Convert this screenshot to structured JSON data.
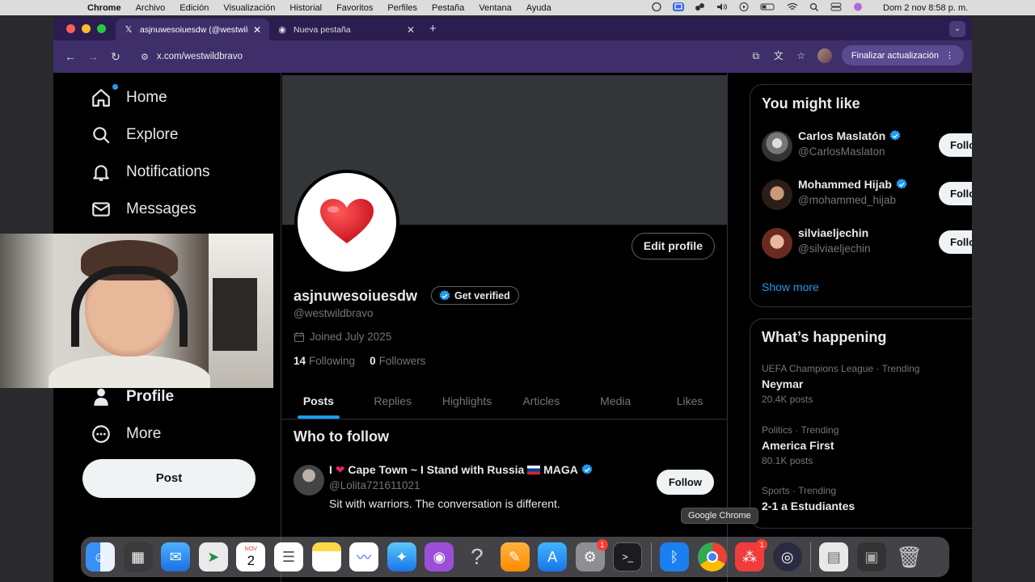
{
  "menubar": {
    "app": "Chrome",
    "items": [
      "Archivo",
      "Edición",
      "Visualización",
      "Historial",
      "Favoritos",
      "Perfiles",
      "Pestaña",
      "Ventana",
      "Ayuda"
    ],
    "clock": "Dom 2 nov 8:58 p. m."
  },
  "browser": {
    "tabs": [
      {
        "title": "asjnuwesoiuesdw (@westwilde",
        "icon": "x-logo-icon"
      },
      {
        "title": "Nueva pestaña",
        "icon": "chrome-icon"
      }
    ],
    "url": "x.com/westwildbravo",
    "update_label": "Finalizar actualización"
  },
  "leftnav": {
    "items": [
      {
        "label": "Home",
        "icon": "home-icon"
      },
      {
        "label": "Explore",
        "icon": "search-icon"
      },
      {
        "label": "Notifications",
        "icon": "bell-icon"
      },
      {
        "label": "Messages",
        "icon": "envelope-icon"
      },
      {
        "label": "Profile",
        "icon": "person-icon"
      },
      {
        "label": "More",
        "icon": "more-circle-icon"
      }
    ],
    "post_label": "Post"
  },
  "profile": {
    "display_name": "asjnuwesoiuesdw",
    "get_verified": "Get verified",
    "handle": "@westwildbravo",
    "joined": "Joined July 2025",
    "following_count": "14",
    "following_label": "Following",
    "followers_count": "0",
    "followers_label": "Followers",
    "edit_label": "Edit profile",
    "tabs": [
      "Posts",
      "Replies",
      "Highlights",
      "Articles",
      "Media",
      "Likes"
    ]
  },
  "who_to_follow": {
    "title": "Who to follow",
    "name_prefix": "I ",
    "name_mid": " Cape Town ~ I Stand with Russia",
    "name_suffix": " MAGA",
    "handle": "@Lolita721611021",
    "bio": "Sit with warriors. The conversation is different.",
    "follow_label": "Follow"
  },
  "you_might_like": {
    "title": "You might like",
    "users": [
      {
        "name": "Carlos Maslatón",
        "handle": "@CarlosMaslaton",
        "verified": true,
        "follow": "Follo"
      },
      {
        "name": "Mohammed Hijab",
        "handle": "@mohammed_hijab",
        "verified": true,
        "follow": "Follo"
      },
      {
        "name": "silviaeljechin",
        "handle": "@silviaeljechin",
        "verified": false,
        "follow": "Follo"
      }
    ],
    "show_more": "Show more"
  },
  "whats_happening": {
    "title": "What’s happening",
    "trends": [
      {
        "category": "UEFA Champions League · Trending",
        "name": "Neymar",
        "count": "20.4K posts"
      },
      {
        "category": "Politics · Trending",
        "name": "America First",
        "count": "80.1K posts"
      },
      {
        "category": "Sports · Trending",
        "name": "2-1 a Estudiantes",
        "count": ""
      }
    ]
  },
  "dock": {
    "tooltip": "Google Chrome",
    "calendar_month": "NOV",
    "calendar_day": "2",
    "badge_settings": "1",
    "badge_app": "1"
  },
  "colors": {
    "accent": "#1d9bf0",
    "background": "#000000",
    "chrome_frame": "#3e2f6a"
  }
}
